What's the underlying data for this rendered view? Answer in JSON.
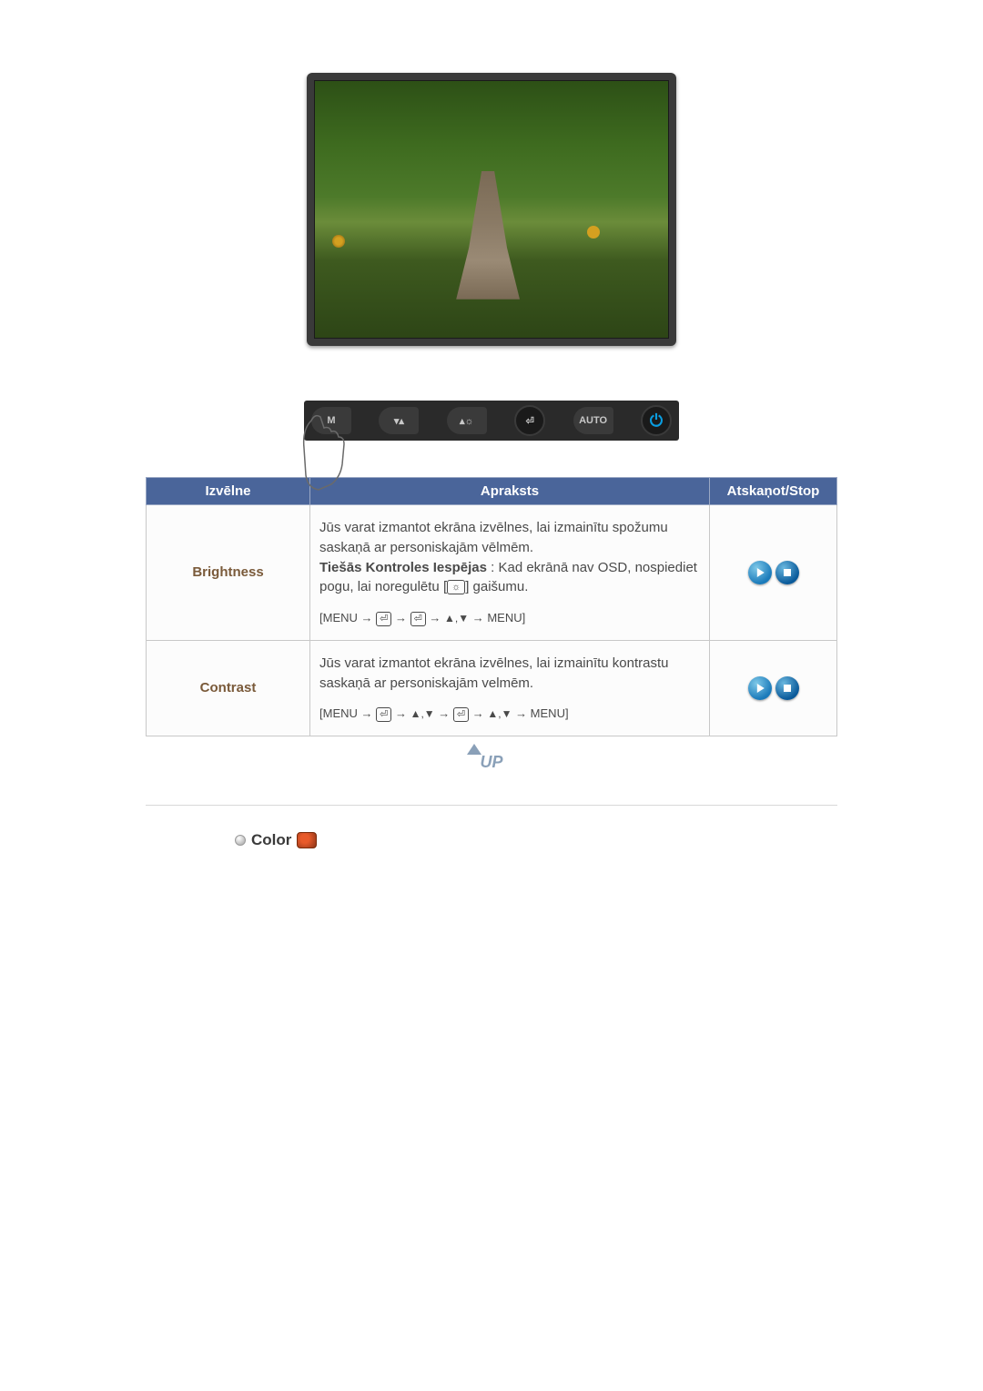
{
  "panel_buttons": {
    "menu": "M",
    "down_up": "▾▴",
    "bright": "▴☼",
    "enter": "⏎",
    "auto": "AUTO",
    "power": "⏻"
  },
  "table": {
    "headers": {
      "menu": "Izvēlne",
      "desc": "Apraksts",
      "play": "Atskaņot/Stop"
    },
    "rows": [
      {
        "name": "Brightness",
        "desc_l1": "Jūs varat izmantot ekrāna izvēlnes, lai izmainītu spožumu saskaņā ar personiskajām vēlmēm.",
        "desc_bold": "Tiešās Kontroles Iespējas",
        "desc_after_bold": " : Kad ekrānā nav OSD, nospiediet pogu, lai noregulētu [",
        "desc_after_icon": "] gaišumu.",
        "path_pre": "[MENU → ",
        "path_mid1": " → ",
        "path_mid2": " → ",
        "path_tri": "▲,▼",
        "path_end": " → MENU]"
      },
      {
        "name": "Contrast",
        "desc_l1": "Jūs varat izmantot ekrāna izvēlnes, lai izmainītu kontrastu saskaņā ar personiskajām velmēm.",
        "path_pre": "[MENU → ",
        "path_mid1": " → ",
        "path_tri": "▲,▼",
        "path_mid2": " → ",
        "path_mid3": " → ",
        "path_end": " → MENU]"
      }
    ]
  },
  "icons": {
    "enter": "⏎",
    "sun": "☼"
  },
  "up_label": "UP",
  "section": {
    "title": "Color"
  }
}
